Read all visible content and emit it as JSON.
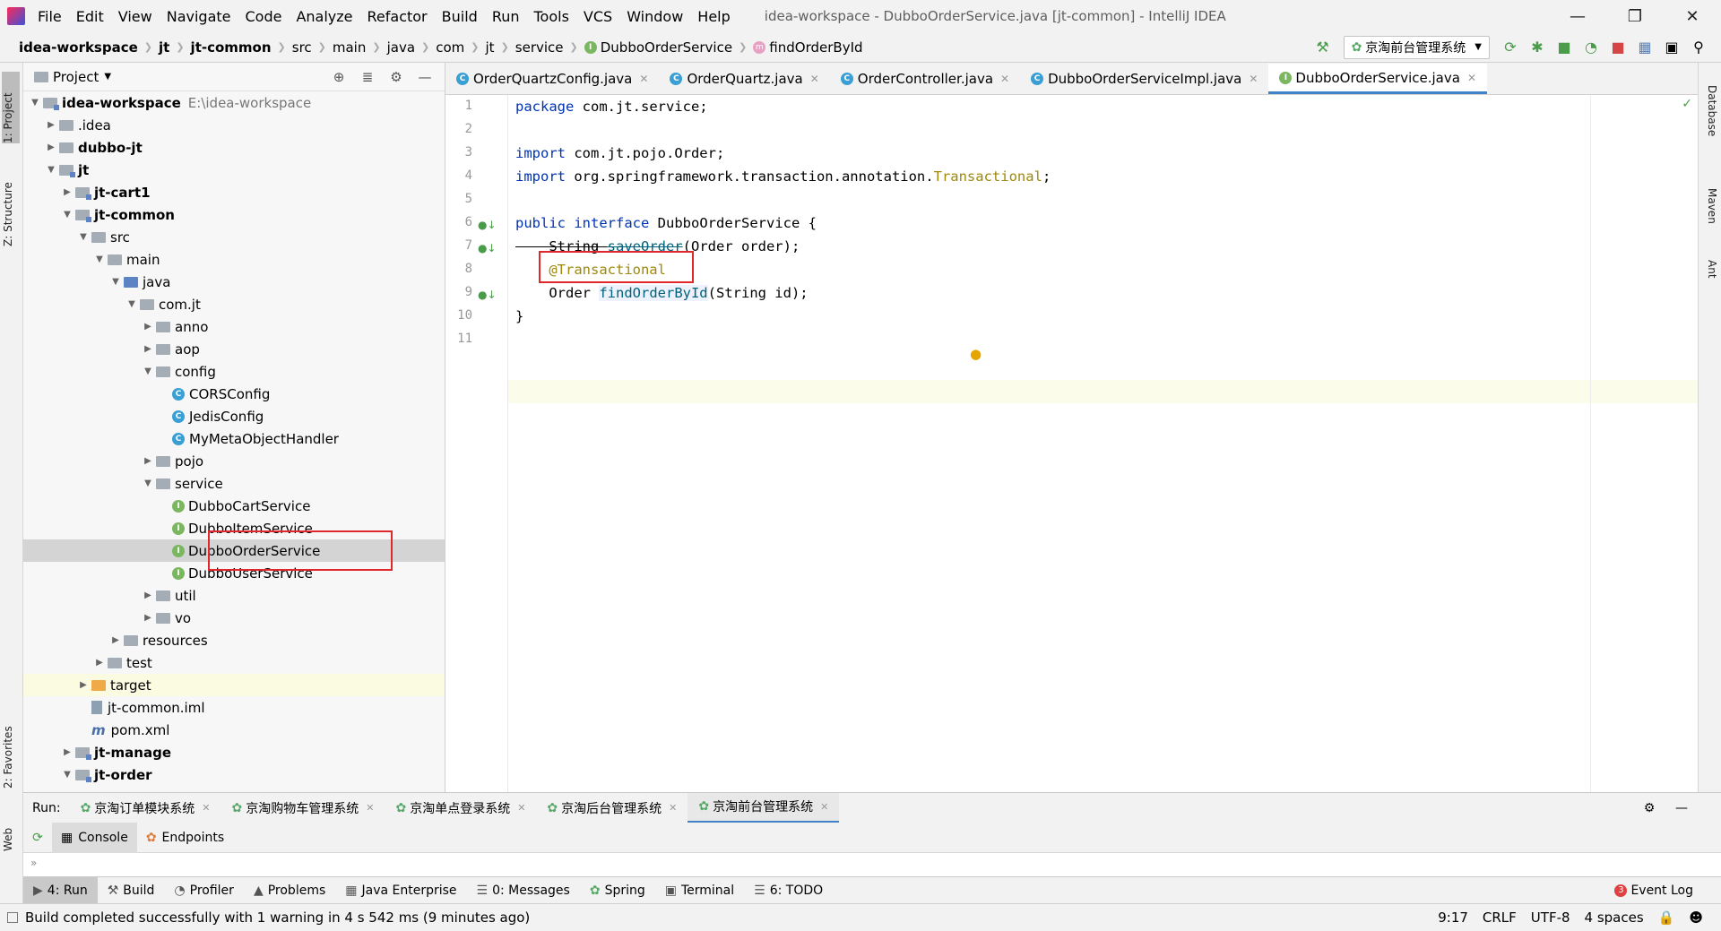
{
  "menu": [
    "File",
    "Edit",
    "View",
    "Navigate",
    "Code",
    "Analyze",
    "Refactor",
    "Build",
    "Run",
    "Tools",
    "VCS",
    "Window",
    "Help"
  ],
  "window_title": "idea-workspace - DubboOrderService.java [jt-common] - IntelliJ IDEA",
  "breadcrumb": [
    "idea-workspace",
    "jt",
    "jt-common",
    "src",
    "main",
    "java",
    "com",
    "jt",
    "service",
    "DubboOrderService",
    "findOrderById"
  ],
  "run_config": "京淘前台管理系统",
  "left_tabs": {
    "project": "1: Project",
    "structure": "Z: Structure",
    "favorites": "2: Favorites",
    "web": "Web"
  },
  "right_tabs": {
    "database": "Database",
    "maven": "Maven",
    "ant": "Ant"
  },
  "project_panel": {
    "title": "Project",
    "nodes": [
      {
        "label": "idea-workspace",
        "path": "E:\\idea-workspace"
      },
      {
        "label": ".idea"
      },
      {
        "label": "dubbo-jt"
      },
      {
        "label": "jt"
      },
      {
        "label": "jt-cart1"
      },
      {
        "label": "jt-common"
      },
      {
        "label": "src"
      },
      {
        "label": "main"
      },
      {
        "label": "java"
      },
      {
        "label": "com.jt"
      },
      {
        "label": "anno"
      },
      {
        "label": "aop"
      },
      {
        "label": "config"
      },
      {
        "label": "CORSConfig"
      },
      {
        "label": "JedisConfig"
      },
      {
        "label": "MyMetaObjectHandler"
      },
      {
        "label": "pojo"
      },
      {
        "label": "service"
      },
      {
        "label": "DubboCartService"
      },
      {
        "label": "DubboItemService"
      },
      {
        "label": "DubboOrderService"
      },
      {
        "label": "DubboUserService"
      },
      {
        "label": "util"
      },
      {
        "label": "vo"
      },
      {
        "label": "resources"
      },
      {
        "label": "test"
      },
      {
        "label": "target"
      },
      {
        "label": "jt-common.iml"
      },
      {
        "label": "pom.xml"
      },
      {
        "label": "jt-manage"
      },
      {
        "label": "jt-order"
      }
    ]
  },
  "editor_tabs": [
    "OrderQuartzConfig.java",
    "OrderQuartz.java",
    "OrderController.java",
    "DubboOrderServiceImpl.java",
    "DubboOrderService.java"
  ],
  "code": {
    "line_numbers": [
      "1",
      "2",
      "3",
      "4",
      "5",
      "6",
      "7",
      "8",
      "9",
      "10",
      "11"
    ],
    "l1a": "package",
    "l1b": " com.jt.service;",
    "l3a": "import",
    "l3b": " com.jt.pojo.Order;",
    "l4a": "import",
    "l4b": " org.springframework.transaction.annotation.",
    "l4c": "Transactional",
    "l4d": ";",
    "l6a": "public",
    "l6b": " ",
    "l6c": "interface",
    "l6d": " DubboOrderService {",
    "l7a": "    String ",
    "l7b": "saveOrder",
    "l7c": "(Order order);",
    "l8a": "    ",
    "l8b": "@Transactional",
    "l9a": "    Order ",
    "l9b": "findOrderById",
    "l9c": "(String id);",
    "l10": "}"
  },
  "run_bar": {
    "label": "Run:",
    "tabs": [
      "京淘订单模块系统",
      "京淘购物车管理系统",
      "京淘单点登录系统",
      "京淘后台管理系统",
      "京淘前台管理系统"
    ]
  },
  "console_bar": {
    "console": "Console",
    "endpoints": "Endpoints"
  },
  "tool_windows": [
    "4: Run",
    "Build",
    "Profiler",
    "Problems",
    "Java Enterprise",
    "0: Messages",
    "Spring",
    "Terminal",
    "6: TODO"
  ],
  "event_log": {
    "count": "3",
    "label": "Event Log"
  },
  "status": {
    "message": "Build completed successfully with 1 warning in 4 s 542 ms (9 minutes ago)",
    "position": "9:17",
    "line_sep": "CRLF",
    "encoding": "UTF-8",
    "indent": "4 spaces"
  },
  "colors": {
    "keyword": "#0033b3",
    "annotation": "#9e880d",
    "method": "#00627a",
    "accent": "#4083c9",
    "highlight_box": "#e0282c"
  }
}
